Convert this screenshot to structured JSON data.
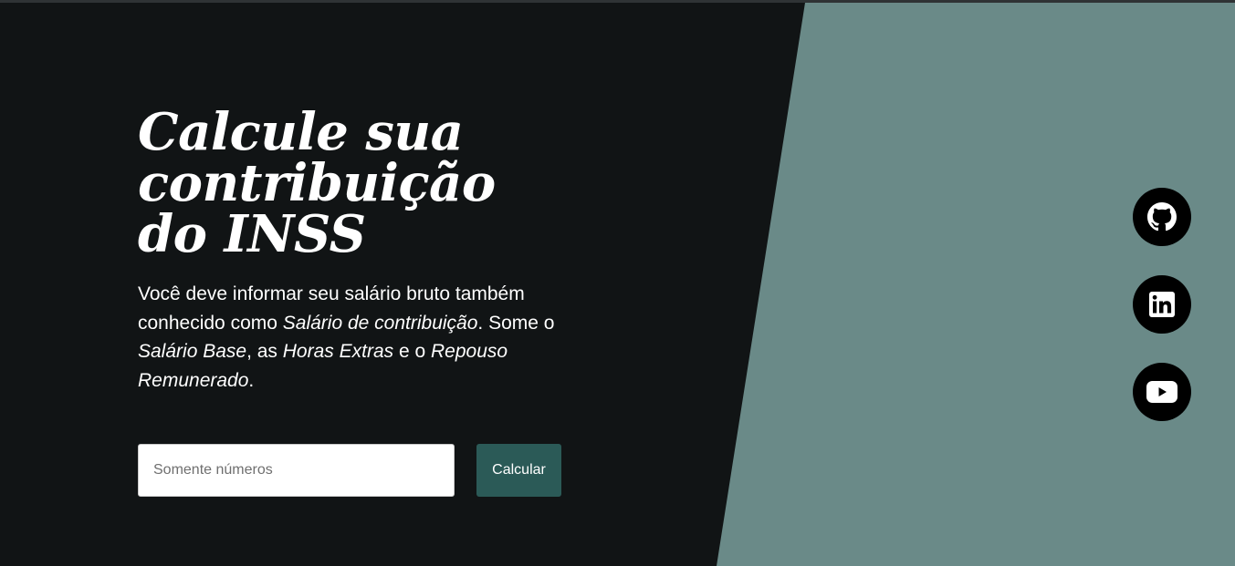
{
  "hero": {
    "title": "Calcule sua contribuição do INSS",
    "description": {
      "part1": "Você deve informar seu salário bruto também conhecido como ",
      "term1": "Salário de contribuição",
      "part2": ". Some o ",
      "term2": "Salário Base",
      "part3": ", as ",
      "term3": "Horas Extras",
      "part4": " e o ",
      "term4": "Repouso Remunerado",
      "part5": "."
    }
  },
  "form": {
    "input_value": "",
    "input_placeholder": "Somente números",
    "button_label": "Calcular"
  },
  "social": [
    {
      "icon": "github-icon",
      "color": "#000000"
    },
    {
      "icon": "linkedin-icon",
      "color": "#000000"
    },
    {
      "icon": "youtube-icon",
      "color": "#000000"
    }
  ],
  "colors": {
    "background": "#111415",
    "panel": "#6a8a88",
    "button": "#2b5a57"
  }
}
